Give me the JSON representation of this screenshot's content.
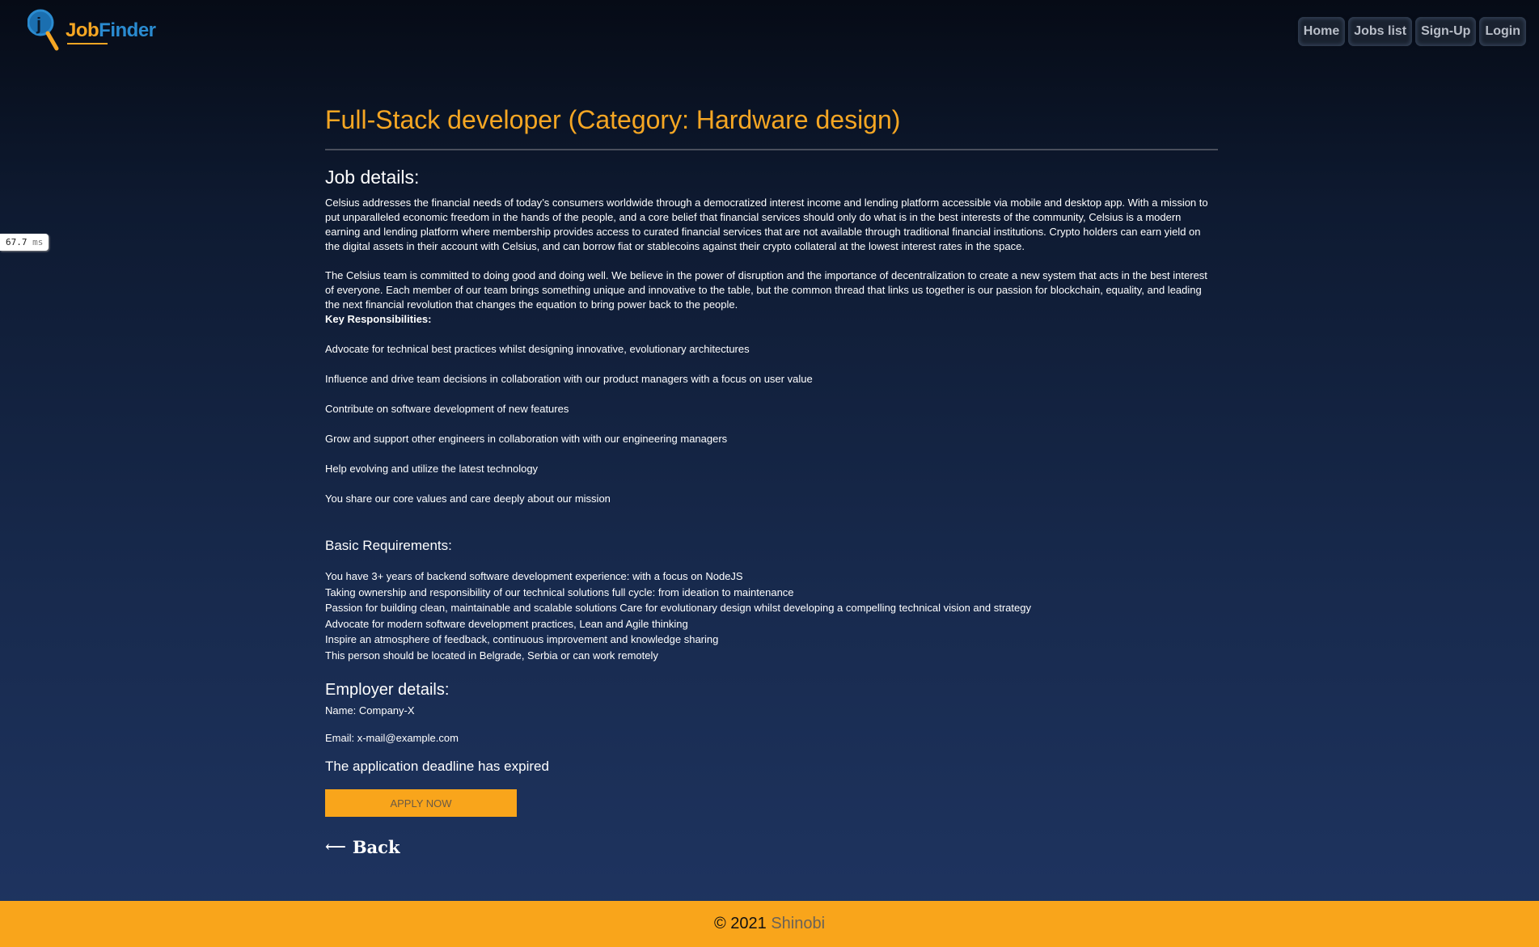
{
  "logo": {
    "word_job": "Job",
    "word_finder": "Finder",
    "icon_letter": "j"
  },
  "nav": {
    "home": "Home",
    "jobs_list": "Jobs list",
    "signup": "Sign-Up",
    "login": "Login"
  },
  "timer": {
    "value": "67.7",
    "unit": "ms"
  },
  "job": {
    "title": "Full-Stack developer (Category: Hardware design)",
    "details_heading": "Job details:",
    "description_1": "Celsius addresses the financial needs of today’s consumers worldwide through a democratized interest income and lending platform accessible via mobile and desktop app. With a mission to put unparalleled economic freedom in the hands of the people, and a core belief that financial services should only do what is in the best interests of the community, Celsius is a modern earning and lending platform where membership provides access to curated financial services that are not available through traditional financial institutions. Crypto holders can earn yield on the digital assets in their account with Celsius, and can borrow fiat or stablecoins against their crypto collateral at the lowest interest rates in the space.",
    "description_2": "The Celsius team is committed to doing good and doing well. We believe in the power of disruption and the importance of decentralization to create a new system that acts in the best interest of everyone. Each member of our team brings something unique and innovative to the table, but the common thread that links us together is our passion for blockchain, equality, and leading the next financial revolution that changes the equation to bring power back to the people.",
    "responsibilities_heading": "Key Responsibilities:",
    "responsibilities": [
      "Advocate for technical best practices whilst designing innovative, evolutionary architectures",
      "Influence and drive team decisions in collaboration with our product managers with a focus on user value",
      "Contribute on software development of new features",
      "Grow and support other engineers in collaboration with with our engineering managers",
      "Help evolving and utilize the latest technology",
      "You share our core values and care deeply about our mission"
    ],
    "requirements_heading": "Basic Requirements:",
    "requirements": [
      "You have 3+ years of backend software development experience: with a focus on NodeJS",
      "Taking ownership and responsibility of our technical solutions full cycle: from ideation to maintenance",
      "Passion for building clean, maintainable and scalable solutions Care for evolutionary design whilst developing a compelling technical vision and strategy",
      "Advocate for modern software development practices, Lean and Agile thinking",
      "Inspire an atmosphere of feedback, continuous improvement and knowledge sharing",
      "This person should be located in Belgrade, Serbia or can work remotely"
    ],
    "employer_heading": "Employer details:",
    "employer_name": "Name: Company-X",
    "employer_email": "Email: x-mail@example.com",
    "deadline_text": "The application deadline has expired",
    "apply_label": "APPLY NOW",
    "back_arrow": "⟵",
    "back_label": "Back"
  },
  "footer": {
    "copyright": "© 2021",
    "brand": "Shinobi"
  },
  "colors": {
    "accent": "#f9a51b",
    "title": "#f5a623",
    "logo_blue": "#2a8bd0"
  }
}
